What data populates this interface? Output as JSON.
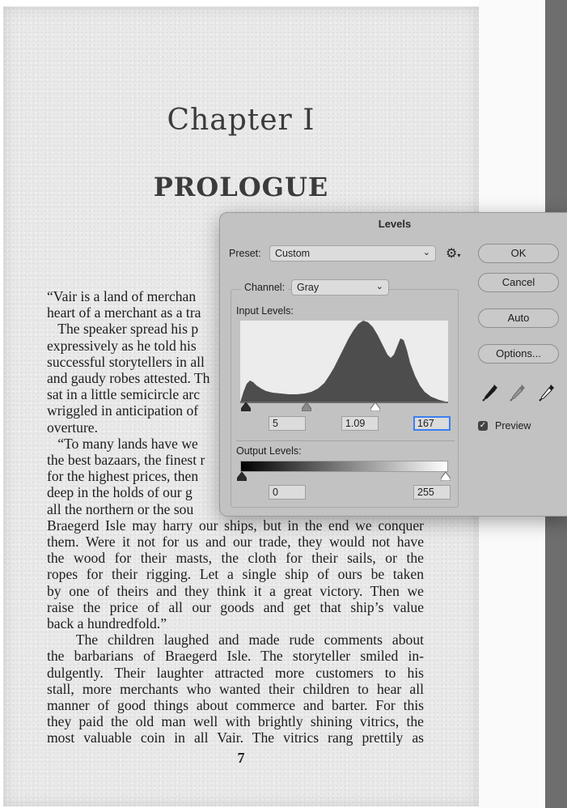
{
  "book": {
    "chapter_number": "Chapter I",
    "chapter_title": "PROLOGUE",
    "page_number": "7",
    "lines": [
      "“Vair is a land of merchan",
      "heart of a merchant as a tra",
      "   The speaker spread his p",
      "expressively as he told his",
      "successful storytellers in all",
      "and gaudy robes attested. Th",
      "sat in a little semicircle arc",
      "wriggled in anticipation of",
      "overture.",
      "   “To many lands have we",
      "the best bazaars, the finest r",
      "for the highest prices, then",
      "deep in the holds of our g",
      "all the northern or the sou",
      "Braegerd Isle may harry our ships, but in the end we conquer",
      "them. Were it not for us and our trade, they would not have",
      "the wood for their masts, the cloth for their sails, or the",
      "ropes for their rigging. Let a single ship of ours be taken",
      "by one of theirs and they think it a great victory. Then we",
      "raise the price of all our goods and get that ship’s value",
      "back a hundredfold.”",
      "   The children laughed and made rude comments about",
      "the barbarians of Braegerd Isle. The storyteller smiled in-",
      "dulgently. Their laughter attracted more customers to his",
      "stall, more merchants who wanted their children to hear all",
      "manner of good things about commerce and barter. For this",
      "they paid the old man well with brightly shining vitrics, the",
      "most valuable coin in all Vair. The vitrics rang prettily as"
    ]
  },
  "dialog": {
    "title": "Levels",
    "preset_label": "Preset:",
    "preset_value": "Custom",
    "gear_icon": "gear-icon",
    "channel_label": "Channel:",
    "channel_value": "Gray",
    "input_levels_label": "Input Levels:",
    "input_black": "5",
    "input_gamma": "1.09",
    "input_white": "167",
    "output_levels_label": "Output Levels:",
    "output_black": "0",
    "output_white": "255",
    "buttons": {
      "ok": "OK",
      "cancel": "Cancel",
      "auto": "Auto",
      "options": "Options..."
    },
    "eyedroppers": [
      "black-eyedropper-icon",
      "gray-eyedropper-icon",
      "white-eyedropper-icon"
    ],
    "preview_label": "Preview",
    "preview_checked": true,
    "histogram_color": "#4d4d4d",
    "histogram_bg": "#ececec"
  }
}
